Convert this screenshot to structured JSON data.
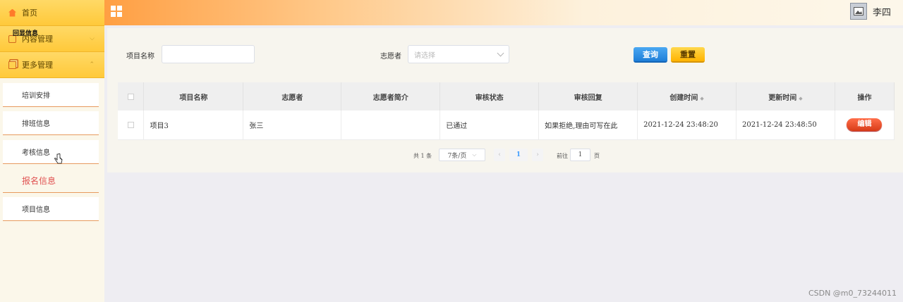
{
  "sidebar": {
    "home_label": "首页",
    "content_mgmt_label": "内容管理",
    "more_mgmt_label": "更多管理",
    "overlay_text": "回显信息",
    "submenu": [
      {
        "label": "培训安排"
      },
      {
        "label": "排班信息"
      },
      {
        "label": "考核信息"
      },
      {
        "label": "报名信息"
      },
      {
        "label": "项目信息"
      }
    ],
    "active_item": "报名信息"
  },
  "header": {
    "user_name": "李四",
    "icons": [
      "grid-menu-icon",
      "avatar-image-icon"
    ]
  },
  "search": {
    "project_name_label": "项目名称",
    "project_name_value": "",
    "volunteer_label": "志愿者",
    "volunteer_placeholder": "请选择",
    "query_button": "查询",
    "reset_button": "重置"
  },
  "table": {
    "headers": [
      "项目名称",
      "志愿者",
      "志愿者简介",
      "审核状态",
      "审核回复",
      "创建时间",
      "更新时间",
      "操作"
    ],
    "rows": [
      {
        "project_name": "项目3",
        "volunteer": "张三",
        "intro": "",
        "status": "已通过",
        "reply": "如果拒绝,理由可写在此",
        "created": "2021-12-24 23:48:20",
        "updated": "2021-12-24 23:48:50",
        "action": "编辑"
      }
    ]
  },
  "pagination": {
    "total_text": "共 1 条",
    "page_size": "7条/页",
    "current_page": "1",
    "goto_label": "前往",
    "goto_value": "1",
    "page_suffix": "页"
  },
  "watermark": "CSDN @m0_73244011",
  "colors": {
    "accent_orange": "#ff9f43",
    "sidebar_yellow": "#ffd966",
    "query_blue": "#1f7ed8",
    "reset_yellow": "#ffb300",
    "edit_red": "#d83c18",
    "active_menu_red": "#e05050"
  }
}
